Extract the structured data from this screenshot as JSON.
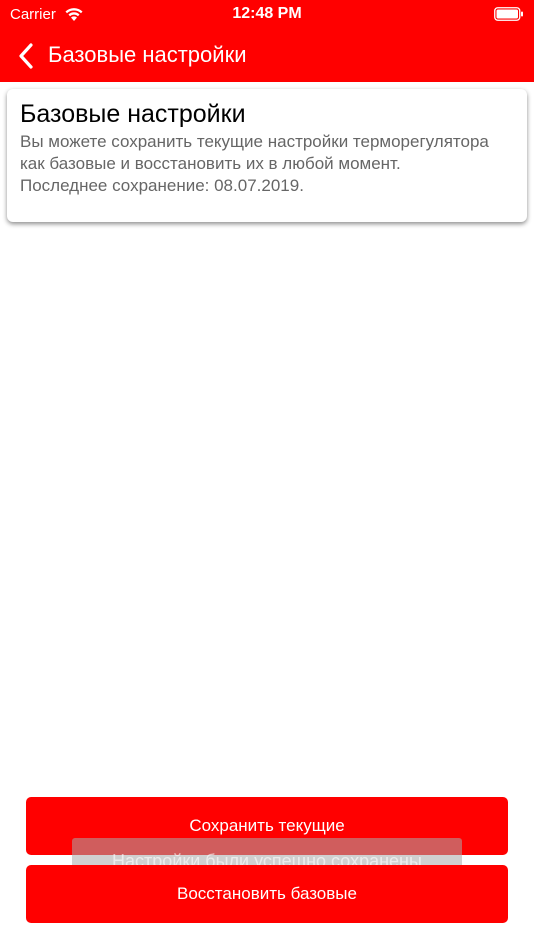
{
  "status_bar": {
    "carrier": "Carrier",
    "time": "12:48 PM"
  },
  "nav": {
    "title": "Базовые настройки"
  },
  "card": {
    "title": "Базовые настройки",
    "description": "Вы можете сохранить текущие настройки терморегулятора как базовые и восстановить их в любой момент.",
    "last_saved": "Последнее сохранение: 08.07.2019."
  },
  "buttons": {
    "save_label": "Сохранить текущие",
    "restore_label": "Восстановить базовые"
  },
  "toast": {
    "message": "Настройки были успешно сохранены"
  },
  "colors": {
    "accent": "#ff0000",
    "text_secondary": "#666666"
  }
}
